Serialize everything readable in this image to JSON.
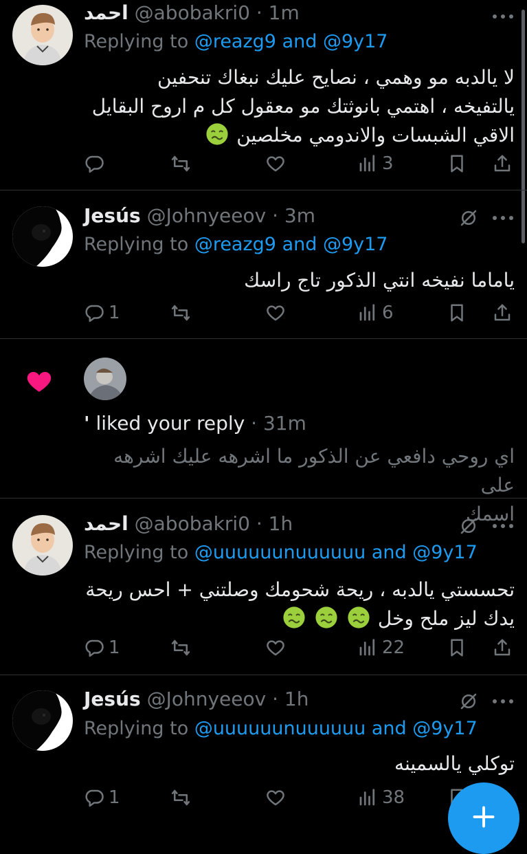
{
  "tweets": [
    {
      "name": "احمد",
      "handle": "@abobakri0",
      "time": "· 1m",
      "replying_prefix": "Replying to",
      "reply_user1": "@reazg9",
      "reply_and": "and",
      "reply_user2": "@9y17",
      "lines": [
        "لا يالدبه مو وهمي ، نصايح عليك نبغاك تنحفين",
        "يالتفيخه ، اهتمي بانوثتك  مو معقول كل م اروح البقايل",
        "الاقي الشبسات والاندومي مخلصين"
      ],
      "reply_count": "",
      "retweet_count": "",
      "like_count": "",
      "views": "3"
    },
    {
      "name": "Jesús",
      "handle": "@Johnyeeov",
      "time": "· 3m",
      "replying_prefix": "Replying to",
      "reply_user1": "@reazg9",
      "reply_and": "and",
      "reply_user2": "@9y17",
      "lines": [
        "ياماما نفيخه انتي الذكور تاج راسك"
      ],
      "reply_count": "1",
      "retweet_count": "",
      "like_count": "",
      "views": "6"
    },
    {
      "name": "احمد",
      "handle": "@abobakri0",
      "time": "· 1h",
      "replying_prefix": "Replying to",
      "reply_user1": "@uuuuuunuuuuuu",
      "reply_and": "and",
      "reply_user2": "@9y17",
      "lines": [
        "تحسستي يالدبه ، ريحة شحومك وصلتني + احس ريحة",
        "يدك ليز ملح وخل"
      ],
      "reply_count": "1",
      "retweet_count": "",
      "like_count": "",
      "views": "22"
    },
    {
      "name": "Jesús",
      "handle": "@Johnyeeov",
      "time": "· 1h",
      "replying_prefix": "Replying to",
      "reply_user1": "@uuuuuunuuuuuu",
      "reply_and": "and",
      "reply_user2": "@9y17",
      "lines": [
        "توكلي يالسمينه"
      ],
      "reply_count": "1",
      "retweet_count": "",
      "like_count": "",
      "views": "38"
    }
  ],
  "notification": {
    "liker_name": "'",
    "action": "liked your reply",
    "time": "· 31m",
    "lines": [
      "اي روحي دافعي عن الذكور ما اشرهه عليك اشرهه على",
      "اسمك"
    ]
  },
  "icons": {
    "reply": "reply-icon",
    "retweet": "retweet-icon",
    "like": "like-icon",
    "views": "views-icon",
    "bookmark": "bookmark-icon",
    "share": "share-icon",
    "more": "more-icon",
    "muted": "muted-icon",
    "heart_notification": "heart-icon",
    "compose": "plus-icon",
    "emoji": "nauseated-face-emoji"
  },
  "colors": {
    "background": "#000000",
    "text": "#e7e9ea",
    "muted": "#71767b",
    "link": "#1d9bf0",
    "heart": "#f91880",
    "divider": "#2f3336",
    "emoji": "#9ccf3c"
  }
}
